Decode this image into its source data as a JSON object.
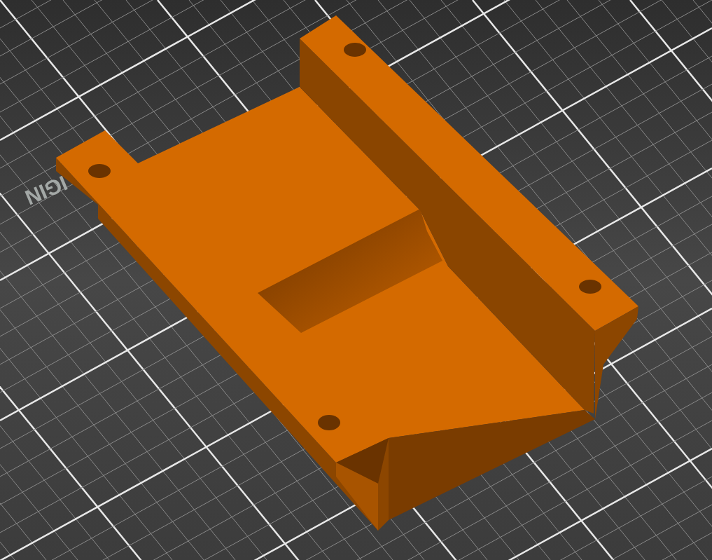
{
  "bed_label": {
    "text": "IGIN"
  }
}
